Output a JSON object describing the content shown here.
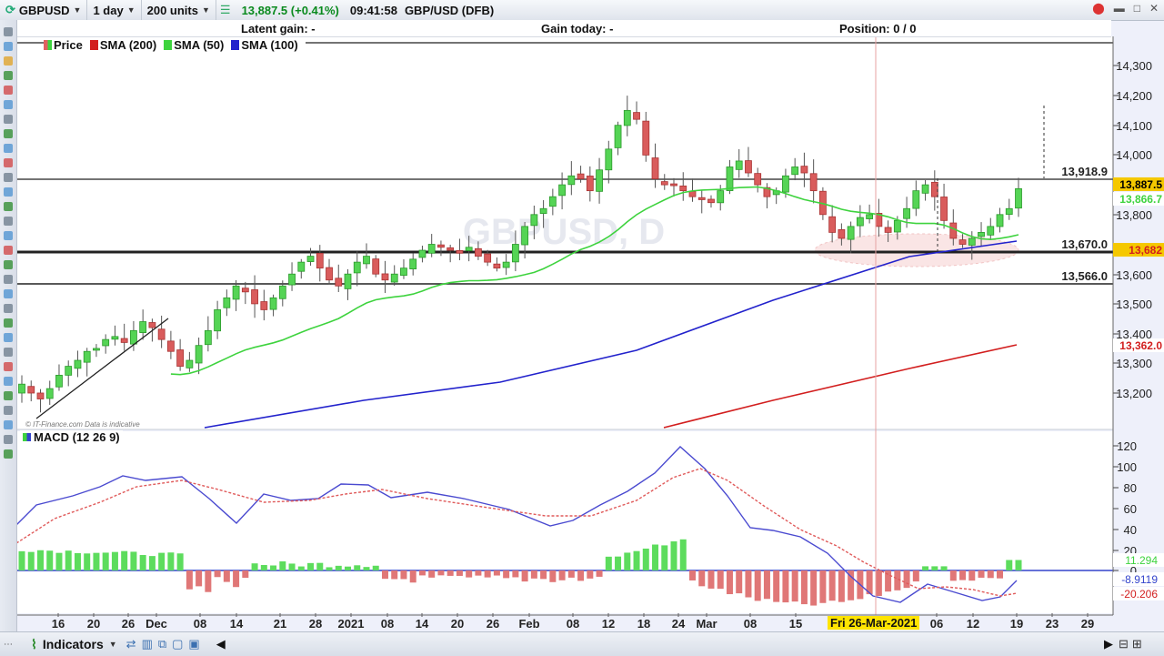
{
  "toolbar": {
    "instrument": "GBPUSD",
    "timeframe": "1 day",
    "units": "200 units",
    "quote": "13,887.5 (+0.41%)",
    "time": "09:41:58",
    "instrument_name": "GBP/USD (DFB)"
  },
  "info": {
    "latent_gain": "Latent gain: -",
    "gain_today": "Gain today: -",
    "position": "Position: 0    / 0"
  },
  "legend": [
    {
      "label": "Price",
      "color": "#e06060"
    },
    {
      "label": "SMA (200)",
      "color": "#d21e1e"
    },
    {
      "label": "SMA (50)",
      "color": "#3ed33e"
    },
    {
      "label": "SMA (100)",
      "color": "#2222cc"
    }
  ],
  "watermark": "GBPUSD, D",
  "source": "© IT-Finance.com  Data is indicative",
  "macd_label": "MACD (12 26 9)",
  "levels": [
    "13,918.9",
    "13,670.0",
    "13,566.0"
  ],
  "price_axis": [
    "14,300",
    "14,200",
    "14,100",
    "14,000",
    "13,800",
    "13,600",
    "13,500",
    "13,400",
    "13,300",
    "13,200"
  ],
  "price_tags": [
    "13,887.5",
    "13,866.7",
    "13,682",
    "13,362.0"
  ],
  "macd_axis": [
    "120",
    "100",
    "80",
    "60",
    "40",
    "20",
    "0"
  ],
  "macd_tags": [
    "11.294",
    "-8.9119",
    "-20.206"
  ],
  "date_axis": [
    "16",
    "20",
    "26",
    "Dec",
    "08",
    "14",
    "21",
    "28",
    "2021",
    "08",
    "14",
    "20",
    "26",
    "Feb",
    "08",
    "12",
    "18",
    "24",
    "Mar",
    "08",
    "15",
    "06",
    "12",
    "19",
    "23",
    "29"
  ],
  "crosshair_date": "Fri 26-Mar-2021",
  "bottom": {
    "indicators": "Indicators"
  }
}
